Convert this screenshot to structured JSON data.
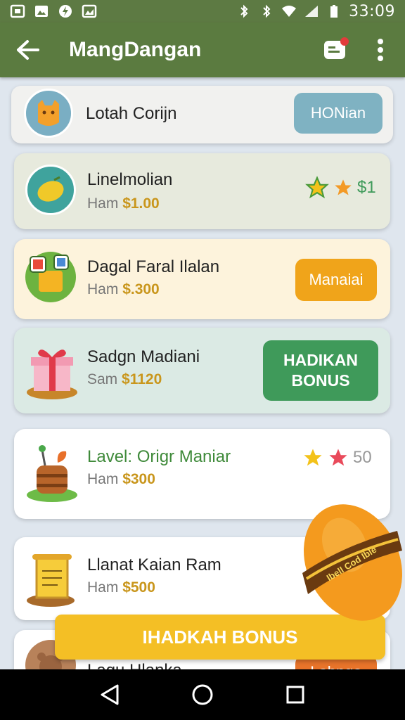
{
  "status_bar": {
    "time": "33:09"
  },
  "app_bar": {
    "title": "MangDangan"
  },
  "items": [
    {
      "title": "Lotah Corijn",
      "action_label": "HONian"
    },
    {
      "title": "Linelmolian",
      "sub_prefix": "Ham",
      "price": "$1.00",
      "rating_value": "$1"
    },
    {
      "title": "Dagal Faral Ilalan",
      "sub_prefix": "Ham",
      "price": "$.300",
      "action_label": "Manaiai"
    },
    {
      "title": "Sadgn Madiani",
      "sub_prefix": "Sam",
      "price": "$1120",
      "action_label": "HADIKAN BONUS"
    },
    {
      "title": "Lavel: Origr Maniar",
      "sub_prefix": "Ham",
      "price": "$300",
      "rating_value": "50"
    },
    {
      "title": "Llanat Kaian Ram",
      "sub_prefix": "Ham",
      "price": "$500"
    },
    {
      "title": "Lagu Hlanka",
      "action_label": "Lahnga"
    }
  ],
  "bonus_bar": {
    "label": "IHADKAH BONUS"
  },
  "scroll_badge": {
    "text": "Ibell Cod Ible"
  },
  "colors": {
    "app_bar": "#5b7b40",
    "accent_orange": "#f0a41a",
    "accent_green": "#3f9a5a",
    "accent_blue": "#7fb2c2",
    "bonus_yellow": "#f4bf25"
  }
}
